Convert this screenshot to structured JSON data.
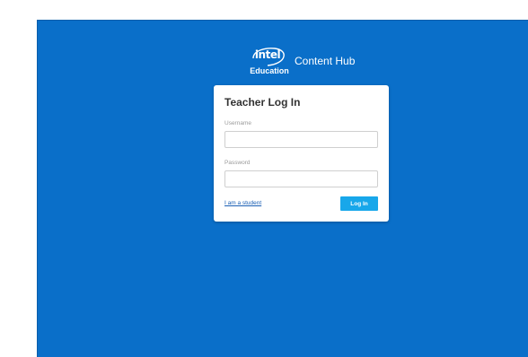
{
  "brand": {
    "logo_word": "intel",
    "logo_sub": "Education",
    "product": "Content Hub",
    "logo_icon": "intel-logo-icon"
  },
  "login": {
    "title": "Teacher Log In",
    "username_label": "Username",
    "username_value": "",
    "password_label": "Password",
    "password_value": "",
    "student_link": "I am a student",
    "submit_label": "Log In"
  },
  "colors": {
    "background": "#0a6fc9",
    "card": "#ffffff",
    "button": "#18a7ea",
    "link": "#1a5fb4"
  }
}
